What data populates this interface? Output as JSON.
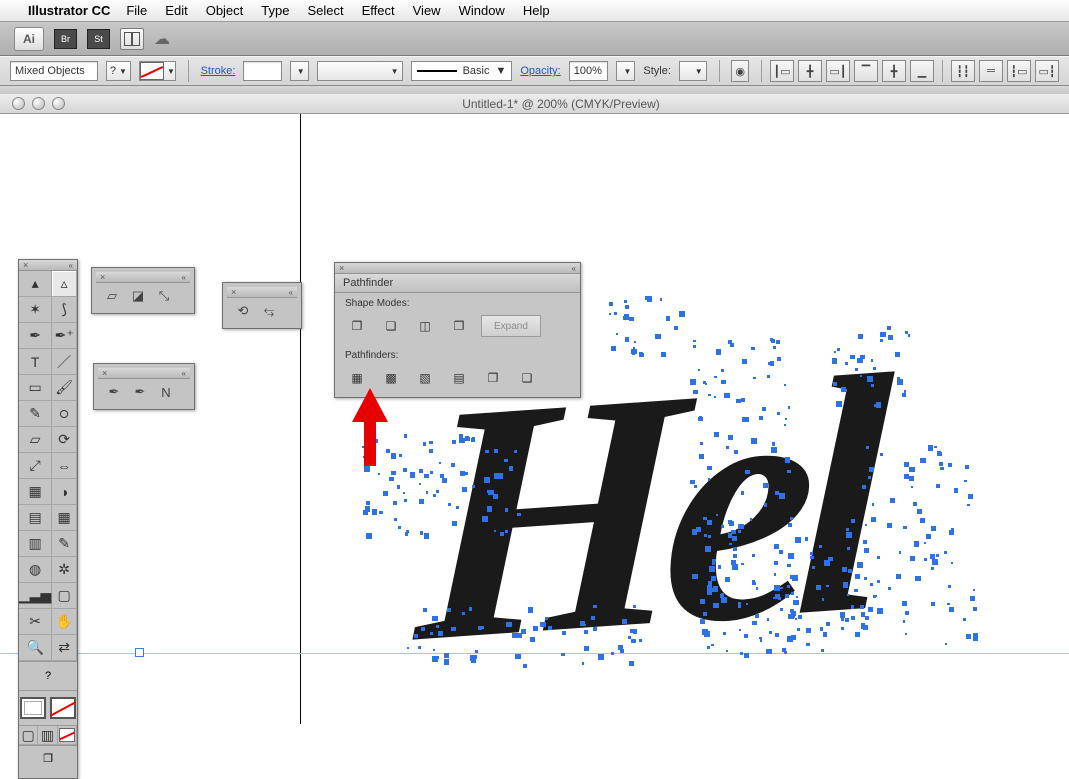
{
  "menubar": {
    "apple": "",
    "app": "Illustrator CC",
    "items": [
      "File",
      "Edit",
      "Object",
      "Type",
      "Select",
      "Effect",
      "View",
      "Window",
      "Help"
    ]
  },
  "appbar1": {
    "ai": "Ai",
    "br": "Br",
    "st": "St"
  },
  "optionsbar": {
    "selection": "Mixed Objects",
    "q": "?",
    "stroke_label": "Stroke:",
    "stroke_weight": "",
    "basic": "Basic",
    "opacity_label": "Opacity:",
    "opacity_value": "100%",
    "style_label": "Style:"
  },
  "doc_title": "Untitled-1* @ 200% (CMYK/Preview)",
  "tools": {
    "q": "?",
    "cells": [
      "sel",
      "dsel",
      "wand",
      "lasso",
      "pen",
      "penplus",
      "type",
      "line",
      "rect",
      "brush",
      "pencil",
      "blob",
      "eraser",
      "rot",
      "scale",
      "width",
      "freet",
      "shapeb",
      "persp",
      "mesh",
      "grad",
      "eye",
      "blend",
      "sym",
      "colg",
      "art",
      "slice",
      "hand",
      "zoom",
      "swap"
    ]
  },
  "pathfinder": {
    "title": "Pathfinder",
    "shape_label": "Shape Modes:",
    "pf_label": "Pathfinders:",
    "expand": "Expand"
  },
  "canvas_text": "Hel"
}
